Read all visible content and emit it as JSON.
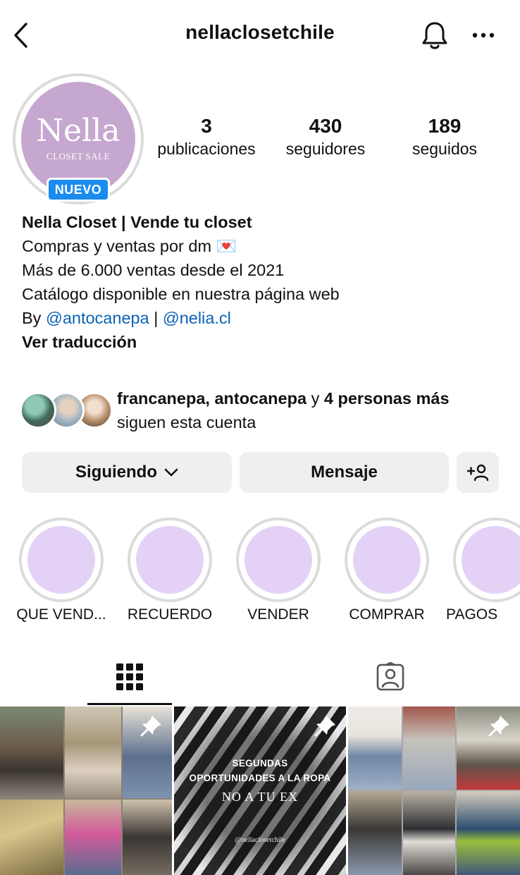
{
  "header": {
    "username": "nellaclosetchile"
  },
  "profile": {
    "avatar_brand": "Nella",
    "avatar_sub": "CLOSET SALE",
    "badge": "NUEVO",
    "stats": [
      {
        "value": "3",
        "label": "publicaciones"
      },
      {
        "value": "430",
        "label": "seguidores"
      },
      {
        "value": "189",
        "label": "seguidos"
      }
    ]
  },
  "bio": {
    "name": "Nella Closet | Vende tu closet",
    "line1": "Compras y ventas por dm",
    "line1_emoji": "💌",
    "line2": "Más de 6.000 ventas desde el 2021",
    "line3": "Catálogo disponible en nuestra página web",
    "by_prefix": "By ",
    "link1": "@antocanepa",
    "separator": " | ",
    "link2": "@nelia.cl",
    "translate": "Ver traducción"
  },
  "followed_by": {
    "names": "francanepa, antocanepa",
    "connector": " y ",
    "others": "4 personas más",
    "suffix": "siguen esta cuenta"
  },
  "actions": {
    "following": "Siguiendo",
    "message": "Mensaje"
  },
  "highlights": [
    {
      "label": "QUE VEND..."
    },
    {
      "label": "RECUERDO"
    },
    {
      "label": "VENDER"
    },
    {
      "label": "COMPRAR"
    },
    {
      "label": "PAGOS"
    }
  ],
  "posts": {
    "post2_line1": "SEGUNDAS",
    "post2_line2": "OPORTUNIDADES A LA ROPA",
    "post2_line3": "NO A TU EX",
    "post2_handle": "@nellaclosetchile"
  },
  "colors": {
    "link": "#0a63b6",
    "badge": "#1a8cf0",
    "avatar_bg": "#c6a7cf",
    "highlight_fill": "#e4d2f6",
    "button_bg": "#efefef"
  }
}
